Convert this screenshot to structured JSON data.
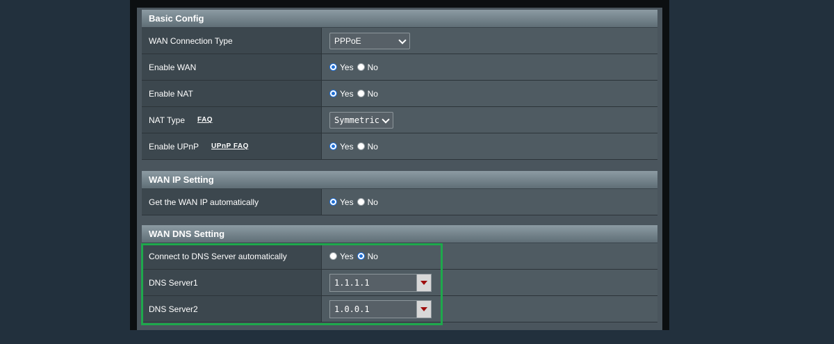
{
  "basic_config": {
    "title": "Basic Config",
    "wan_connection_type": {
      "label": "WAN Connection Type",
      "value": "PPPoE"
    },
    "enable_wan": {
      "label": "Enable WAN",
      "yes": "Yes",
      "no": "No",
      "selected": "Yes"
    },
    "enable_nat": {
      "label": "Enable NAT",
      "yes": "Yes",
      "no": "No",
      "selected": "Yes"
    },
    "nat_type": {
      "label": "NAT Type",
      "faq": "FAQ",
      "value": "Symmetric"
    },
    "enable_upnp": {
      "label": "Enable UPnP",
      "faq": "UPnP FAQ",
      "yes": "Yes",
      "no": "No",
      "selected": "Yes"
    }
  },
  "wan_ip_setting": {
    "title": "WAN IP Setting",
    "get_ip_auto": {
      "label": "Get the WAN IP automatically",
      "yes": "Yes",
      "no": "No",
      "selected": "Yes"
    }
  },
  "wan_dns_setting": {
    "title": "WAN DNS Setting",
    "connect_dns_auto": {
      "label": "Connect to DNS Server automatically",
      "yes": "Yes",
      "no": "No",
      "selected": "No"
    },
    "dns_server1": {
      "label": "DNS Server1",
      "value": "1.1.1.1"
    },
    "dns_server2": {
      "label": "DNS Server2",
      "value": "1.0.0.1"
    }
  },
  "colors": {
    "highlight": "#1ea84c",
    "radio_selected": "#1f6fd6",
    "dropdown_arrow": "#9d0d0d"
  }
}
